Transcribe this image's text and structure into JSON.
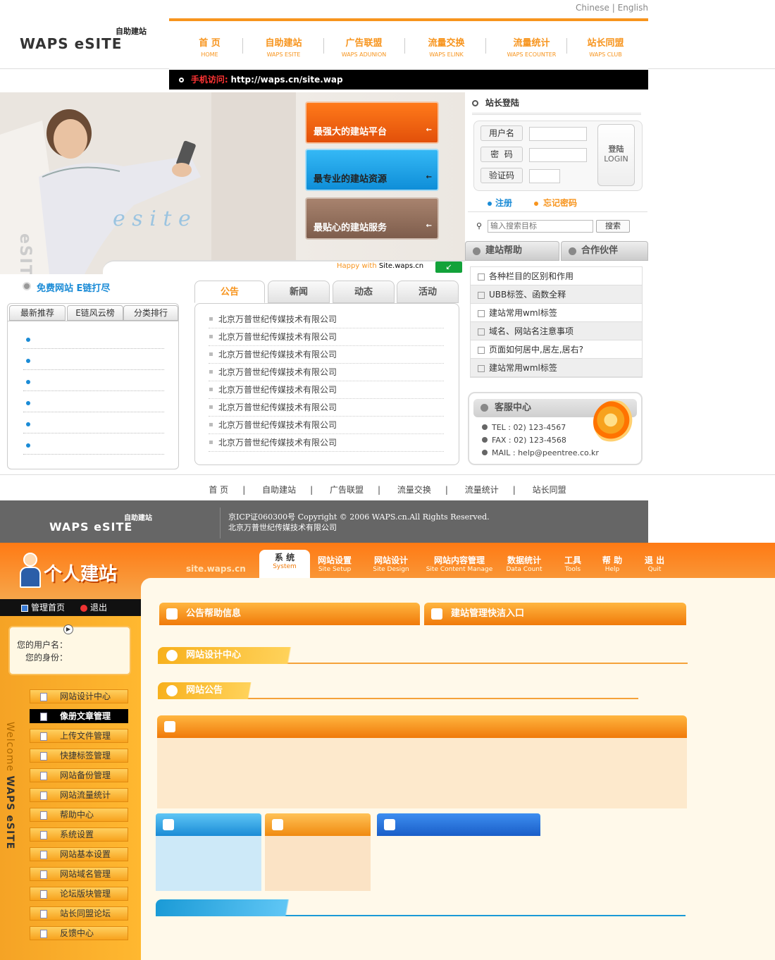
{
  "header": {
    "lang": {
      "cn": "Chinese",
      "sep": "|",
      "en": "English"
    },
    "logo": {
      "brand": "WAPS eSITE",
      "tag": "自助建站"
    },
    "nav": [
      {
        "cn": "首 页",
        "en": "HOME"
      },
      {
        "cn": "自助建站",
        "en": "WAPS ESITE"
      },
      {
        "cn": "广告联盟",
        "en": "WAPS ADUNION"
      },
      {
        "cn": "流量交换",
        "en": "WAPS ELINK"
      },
      {
        "cn": "流量统计",
        "en": "WAPS ECOUNTER"
      },
      {
        "cn": "站长同盟",
        "en": "WAPS CLUB"
      }
    ],
    "mobile_label": "手机访问:",
    "mobile_url": "http://waps.cn/site.wap"
  },
  "banner": {
    "buttons": [
      "最强大的建站平台",
      "最专业的建站资源",
      "最贴心的建站服务"
    ],
    "side_text": "eSITE",
    "caption_happy": "Happy with",
    "caption_site": "Site.waps.cn"
  },
  "login": {
    "title": "站长登陆",
    "username_label": "用户名",
    "password_label": "密  码",
    "captcha_label": "验证码",
    "login_cn": "登陆",
    "login_en": "LOGIN",
    "register": "注册",
    "forgot": "忘记密码"
  },
  "search": {
    "placeholder": "输入搜索目标",
    "button": "搜索"
  },
  "help_tabs": [
    "建站帮助",
    "合作伙伴"
  ],
  "help_items": [
    "各种栏目的区别和作用",
    "UBB标签、函数全释",
    "建站常用wml标签",
    "域名、网站名注意事项",
    "页面如何居中,居左,居右?",
    "建站常用wml标签"
  ],
  "service": {
    "title": "客服中心",
    "tel": "TEL : 02) 123-4567",
    "fax": "FAX : 02) 123-4568",
    "mail": "MAIL : help@peentree.co.kr"
  },
  "free": {
    "title": "免费网站 E链打尽"
  },
  "left_tabs": [
    "最新推荐",
    "E链风云榜",
    "分类排行"
  ],
  "news_tabs": [
    "公告",
    "新闻",
    "动态",
    "活动"
  ],
  "news_items": [
    "北京万普世纪传媒技术有限公司",
    "北京万普世纪传媒技术有限公司",
    "北京万普世纪传媒技术有限公司",
    "北京万普世纪传媒技术有限公司",
    "北京万普世纪传媒技术有限公司",
    "北京万普世纪传媒技术有限公司",
    "北京万普世纪传媒技术有限公司",
    "北京万普世纪传媒技术有限公司"
  ],
  "footer": {
    "links": [
      "首 页",
      "自助建站",
      "广告联盟",
      "流量交换",
      "流量统计",
      "站长同盟"
    ],
    "sep": "|",
    "copyright": "京ICP证060300号 Copyright © 2006 WAPS.cn.All Rights Reserved.",
    "company": "北京万普世纪传媒技术有限公司"
  },
  "admin": {
    "title": "个人建站",
    "site": "site.waps.cn",
    "tabs": [
      {
        "cn": "系 统",
        "en": "System"
      },
      {
        "cn": "网站设置",
        "en": "Site Setup"
      },
      {
        "cn": "网站设计",
        "en": "Site Design"
      },
      {
        "cn": "网站内容管理",
        "en": "Site Content Manage"
      },
      {
        "cn": "数据统计",
        "en": "Data Count"
      },
      {
        "cn": "工具",
        "en": "Tools"
      },
      {
        "cn": "帮 助",
        "en": "Help"
      },
      {
        "cn": "退 出",
        "en": "Quit"
      }
    ],
    "home": "管理首页",
    "logout": "退出",
    "user_label": "您的用户名：",
    "role_label": "您的身份：",
    "welcome": "Welcome",
    "menu": [
      "网站设计中心",
      "像册文章管理",
      "上传文件管理",
      "快捷标签管理",
      "网站备份管理",
      "网站流量统计",
      "帮助中心",
      "系统设置",
      "网站基本设置",
      "网站域名管理",
      "论坛版块管理",
      "站长同盟论坛",
      "反馈中心"
    ],
    "bar_notice": "公告帮助信息",
    "bar_quick": "建站管理快洁入口",
    "bar_design": "网站设计中心",
    "bar_announce": "网站公告"
  },
  "colors": {
    "accent": "#f7941d",
    "blue": "#1a8bd6",
    "dark": "#666666"
  }
}
